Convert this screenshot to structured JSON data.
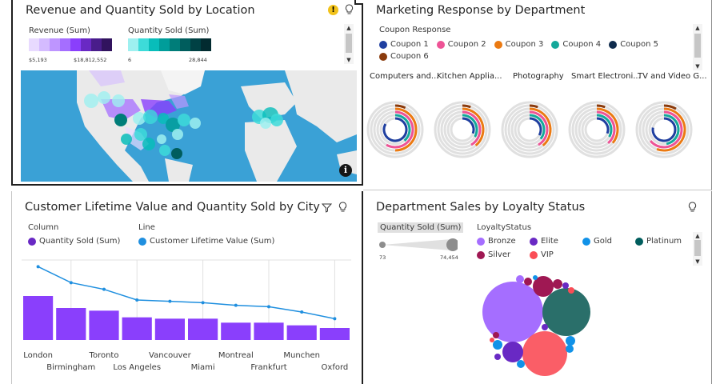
{
  "panel1": {
    "title": "Revenue and Quantity Sold by Location",
    "revenue_legend": {
      "label": "Revenue (Sum)",
      "min": "$5,193",
      "max": "$18,812,552",
      "colors": [
        "#e8daff",
        "#d4bbff",
        "#be95ff",
        "#a56eff",
        "#8a3ffc",
        "#6929c4",
        "#491d8b",
        "#31135e"
      ]
    },
    "quantity_legend": {
      "label": "Quantity Sold (Sum)",
      "min": "6",
      "max": "28,844",
      "colors": [
        "#9ef0f0",
        "#3ddbd9",
        "#08bdba",
        "#009d9a",
        "#007d79",
        "#005d5d",
        "#004144",
        "#022b30"
      ]
    }
  },
  "panel2": {
    "title": "Marketing Response by Department",
    "legend_title": "Coupon Response",
    "coupons": [
      {
        "name": "Coupon 1",
        "color": "#1f3fa0"
      },
      {
        "name": "Coupon 2",
        "color": "#ee5396"
      },
      {
        "name": "Coupon 3",
        "color": "#eb7a12"
      },
      {
        "name": "Coupon 4",
        "color": "#14a89a"
      },
      {
        "name": "Coupon 5",
        "color": "#0f2b4c"
      },
      {
        "name": "Coupon 6",
        "color": "#8a3a0c"
      }
    ],
    "departments": [
      "Computers and...",
      "Kitchen Applia...",
      "Photography",
      "Smart Electroni...",
      "TV and Video G..."
    ]
  },
  "panel3": {
    "title": "Customer Lifetime Value and Quantity Sold by City",
    "column_legend_title": "Column",
    "column_series": "Quantity Sold (Sum)",
    "line_legend_title": "Line",
    "line_series": "Customer Lifetime Value (Sum)",
    "colors": {
      "column": "#8a3ffc",
      "column_dot": "#6929c4",
      "line": "#1f8fdf"
    },
    "chart_data": {
      "type": "bar",
      "categories": [
        "London",
        "Birmingham",
        "Toronto",
        "Los Angeles",
        "Vancouver",
        "Miami",
        "Montreal",
        "Frankfurt",
        "Munchen",
        "Oxford"
      ],
      "series": [
        {
          "name": "Quantity Sold (Sum)",
          "values": [
            33,
            24,
            22,
            17,
            16,
            16,
            13,
            13,
            11,
            9
          ]
        },
        {
          "name": "Customer Lifetime Value (Sum)",
          "values": [
            55,
            43,
            38,
            30,
            29,
            28,
            26,
            25,
            21,
            16
          ]
        }
      ]
    }
  },
  "panel4": {
    "title": "Department Sales by Loyalty Status",
    "size_legend_label": "Quantity Sold (Sum)",
    "size_min": "73",
    "size_max": "74,454",
    "legend_title": "LoyaltyStatus",
    "statuses": [
      {
        "name": "Bronze",
        "color": "#a56eff"
      },
      {
        "name": "Elite",
        "color": "#6929c4"
      },
      {
        "name": "Gold",
        "color": "#1192e8"
      },
      {
        "name": "Platinum",
        "color": "#005d5d"
      },
      {
        "name": "Silver",
        "color": "#9f1853"
      },
      {
        "name": "VIP",
        "color": "#fa4d56"
      }
    ]
  }
}
